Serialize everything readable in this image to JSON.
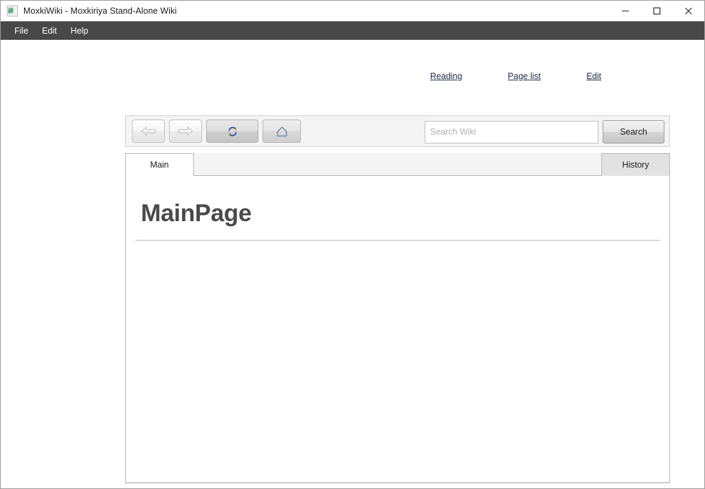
{
  "window": {
    "title": "MoxkiWiki - Moxkiriya Stand-Alone Wiki",
    "icon": "app-window-icon",
    "controls": {
      "minimize": "minimize-icon",
      "maximize": "maximize-icon",
      "close": "close-icon"
    }
  },
  "menubar": {
    "items": [
      {
        "label": "File"
      },
      {
        "label": "Edit"
      },
      {
        "label": "Help"
      }
    ]
  },
  "nav_links": [
    {
      "label": "Reading"
    },
    {
      "label": "Page list"
    },
    {
      "label": "Edit"
    }
  ],
  "toolbar": {
    "buttons": [
      {
        "name": "back-button",
        "icon": "arrow-left-icon",
        "enabled": false
      },
      {
        "name": "forward-button",
        "icon": "arrow-right-icon",
        "enabled": false
      },
      {
        "name": "refresh-button",
        "icon": "refresh-icon",
        "enabled": true
      },
      {
        "name": "home-button",
        "icon": "home-icon",
        "enabled": true
      }
    ]
  },
  "search": {
    "value": "",
    "placeholder": "Search Wiki",
    "button_label": "Search"
  },
  "tabs": [
    {
      "label": "Main",
      "active": true
    },
    {
      "label": "History",
      "active": false
    }
  ],
  "content": {
    "heading": "MainPage",
    "body": ""
  },
  "colors": {
    "menubar_bg": "#484848",
    "link": "#1c2b4a",
    "heading": "#4a4a4a",
    "panel_bg": "#f4f4f4",
    "border": "#b5b5b5",
    "refresh_blue": "#2c63a8",
    "refresh_orange": "#e08a20",
    "home_outline": "#5b7fa6"
  }
}
